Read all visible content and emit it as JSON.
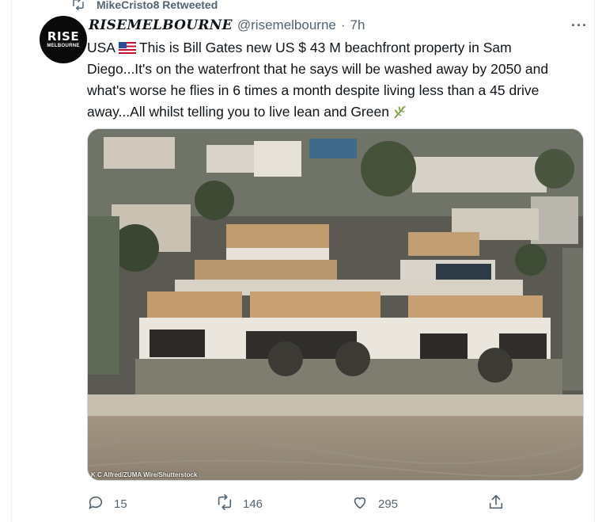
{
  "retweet": {
    "icon": "retweet-icon",
    "label": "MikeCristo8 Retweeted"
  },
  "tweet": {
    "avatar": {
      "line1": "RISE",
      "line2": "MELBOURNE"
    },
    "display_name": "RISEMELBOURNE",
    "handle": "@risemelbourne",
    "separator": "·",
    "time": "7h",
    "more_label": "···",
    "text_before_flag": "USA",
    "text_after_flag": "This is Bill Gates new US $ 43 M beachfront property in Sam Diego...It's on the waterfront that he says will be washed away by 2050 and what's worse he flies in 6 times a month despite living less than a 45 drive away...All whilst telling you to live lean and Green",
    "media": {
      "credit": "K C Alfred/ZUMA Wire/Shutterstock"
    },
    "actions": {
      "reply_count": "15",
      "retweet_count": "146",
      "like_count": "295"
    }
  },
  "colors": {
    "secondary_text": "#536471",
    "primary_text": "#0f1419",
    "border": "#cfd9de"
  }
}
